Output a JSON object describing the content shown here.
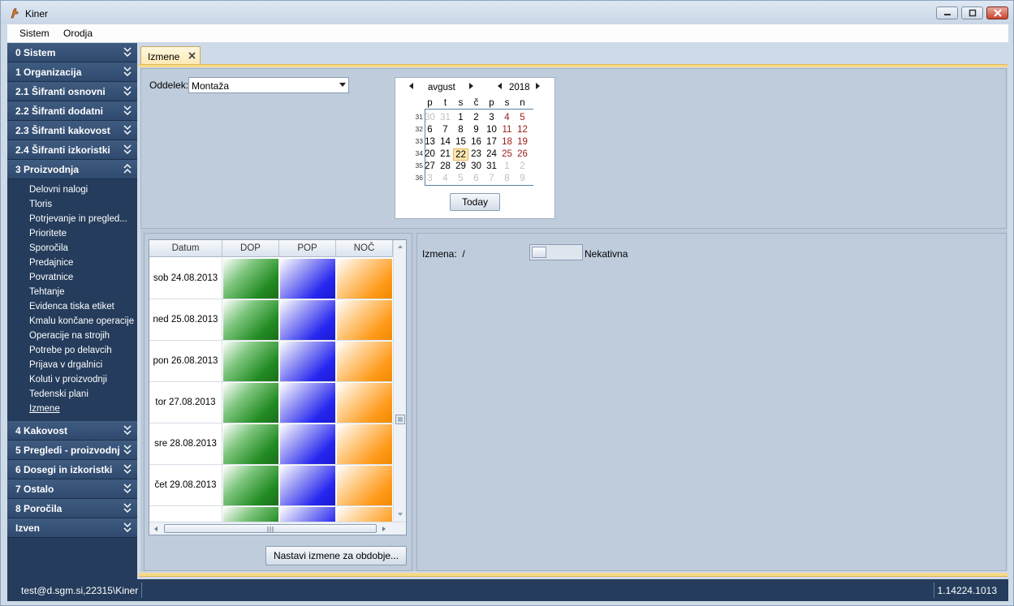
{
  "window": {
    "title": "Kiner"
  },
  "menu": {
    "items": [
      "Sistem",
      "Orodja"
    ]
  },
  "sidebar": {
    "groups_top": [
      {
        "label": "0 Sistem"
      },
      {
        "label": "1 Organizacija"
      },
      {
        "label": "2.1 Šifranti osnovni"
      },
      {
        "label": "2.2 Šifranti dodatni"
      },
      {
        "label": "2.3 Šifranti kakovost"
      },
      {
        "label": "2.4 Šifranti izkoristki"
      }
    ],
    "expanded_group": {
      "label": "3 Proizvodnja"
    },
    "subitems": [
      "Delovni nalogi",
      "Tloris",
      "Potrjevanje in pregled...",
      "Prioritete",
      "Sporočila",
      "Predajnice",
      "Povratnice",
      "Tehtanje",
      "Evidenca tiska etiket",
      "Kmalu končane operacije",
      "Operacije na strojih",
      "Potrebe po delavcih",
      "Prijava v drgalnici",
      "Koluti v proizvodnji",
      "Tedenski plani",
      "Izmene"
    ],
    "active_subitem": "Izmene",
    "groups_bottom": [
      {
        "label": "4 Kakovost"
      },
      {
        "label": "5 Pregledi - proizvodnj"
      },
      {
        "label": "6 Dosegi in izkoristki"
      },
      {
        "label": "7 Ostalo"
      },
      {
        "label": "8 Poročila"
      },
      {
        "label": "Izven"
      }
    ]
  },
  "tab": {
    "label": "Izmene"
  },
  "filter": {
    "label": "Oddelek:",
    "value": "Montaža"
  },
  "calendar": {
    "month": "avgust",
    "year": "2018",
    "dow": [
      "p",
      "t",
      "s",
      "č",
      "p",
      "s",
      "n"
    ],
    "weeks": [
      {
        "wk": "31",
        "days": [
          {
            "d": "30",
            "t": "other"
          },
          {
            "d": "31",
            "t": "other"
          },
          {
            "d": "1"
          },
          {
            "d": "2"
          },
          {
            "d": "3"
          },
          {
            "d": "4",
            "t": "weekend"
          },
          {
            "d": "5",
            "t": "weekend"
          }
        ]
      },
      {
        "wk": "32",
        "days": [
          {
            "d": "6"
          },
          {
            "d": "7"
          },
          {
            "d": "8"
          },
          {
            "d": "9"
          },
          {
            "d": "10"
          },
          {
            "d": "11",
            "t": "weekend"
          },
          {
            "d": "12",
            "t": "weekend"
          }
        ]
      },
      {
        "wk": "33",
        "days": [
          {
            "d": "13"
          },
          {
            "d": "14"
          },
          {
            "d": "15"
          },
          {
            "d": "16"
          },
          {
            "d": "17"
          },
          {
            "d": "18",
            "t": "weekend"
          },
          {
            "d": "19",
            "t": "weekend"
          }
        ]
      },
      {
        "wk": "34",
        "days": [
          {
            "d": "20"
          },
          {
            "d": "21"
          },
          {
            "d": "22",
            "t": "today"
          },
          {
            "d": "23"
          },
          {
            "d": "24"
          },
          {
            "d": "25",
            "t": "weekend"
          },
          {
            "d": "26",
            "t": "weekend"
          }
        ]
      },
      {
        "wk": "35",
        "days": [
          {
            "d": "27"
          },
          {
            "d": "28"
          },
          {
            "d": "29"
          },
          {
            "d": "30"
          },
          {
            "d": "31"
          },
          {
            "d": "1",
            "t": "other"
          },
          {
            "d": "2",
            "t": "other"
          }
        ]
      },
      {
        "wk": "36",
        "days": [
          {
            "d": "3",
            "t": "other"
          },
          {
            "d": "4",
            "t": "other"
          },
          {
            "d": "5",
            "t": "other"
          },
          {
            "d": "6",
            "t": "other"
          },
          {
            "d": "7",
            "t": "other"
          },
          {
            "d": "8",
            "t": "other"
          },
          {
            "d": "9",
            "t": "other"
          }
        ]
      }
    ],
    "today_label": "Today"
  },
  "grid": {
    "columns": [
      "Datum",
      "DOP",
      "POP",
      "NOČ"
    ],
    "rows": [
      "sob 24.08.2013",
      "ned 25.08.2013",
      "pon 26.08.2013",
      "tor 27.08.2013",
      "sre 28.08.2013",
      "čet 29.08.2013",
      ""
    ],
    "shift_colors": {
      "DOP": "#228b22",
      "POP": "#2626f0",
      "NOČ": "#ff9a1a"
    }
  },
  "buttons": {
    "set_period": "Nastavi izmene za obdobje..."
  },
  "detail": {
    "izmena_label": "Izmena:",
    "izmena_value": "/",
    "status_label": "Nekativna"
  },
  "status": {
    "user": "test@d.sgm.si,22315\\Kiner",
    "version": "1.14224.1013"
  }
}
